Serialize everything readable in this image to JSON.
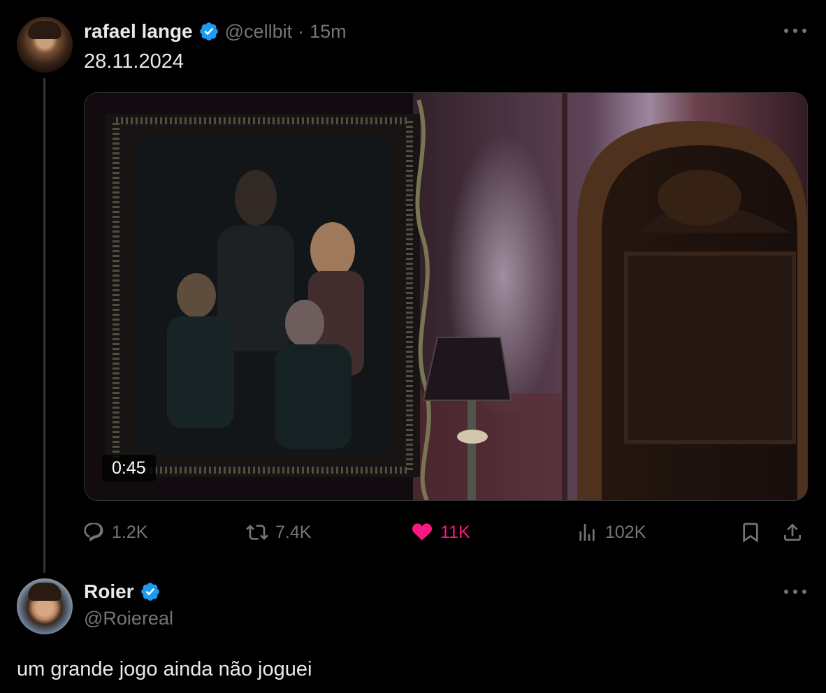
{
  "tweet1": {
    "author_name": "rafael lange",
    "handle": "@cellbit",
    "separator": "·",
    "time": "15m",
    "text": "28.11.2024",
    "video_duration": "0:45",
    "replies": "1.2K",
    "reposts": "7.4K",
    "likes": "11K",
    "views": "102K",
    "liked": true,
    "like_color": "#f91880",
    "verified_color": "#1d9bf0"
  },
  "tweet2": {
    "author_name": "Roier",
    "handle": "@Roiereal",
    "text": "um grande jogo ainda não joguei",
    "verified_color": "#1d9bf0"
  },
  "icons": {
    "reply": "reply-icon",
    "repost": "repost-icon",
    "like": "heart-icon",
    "views": "views-icon",
    "bookmark": "bookmark-icon",
    "share": "share-icon",
    "more": "more-icon"
  }
}
